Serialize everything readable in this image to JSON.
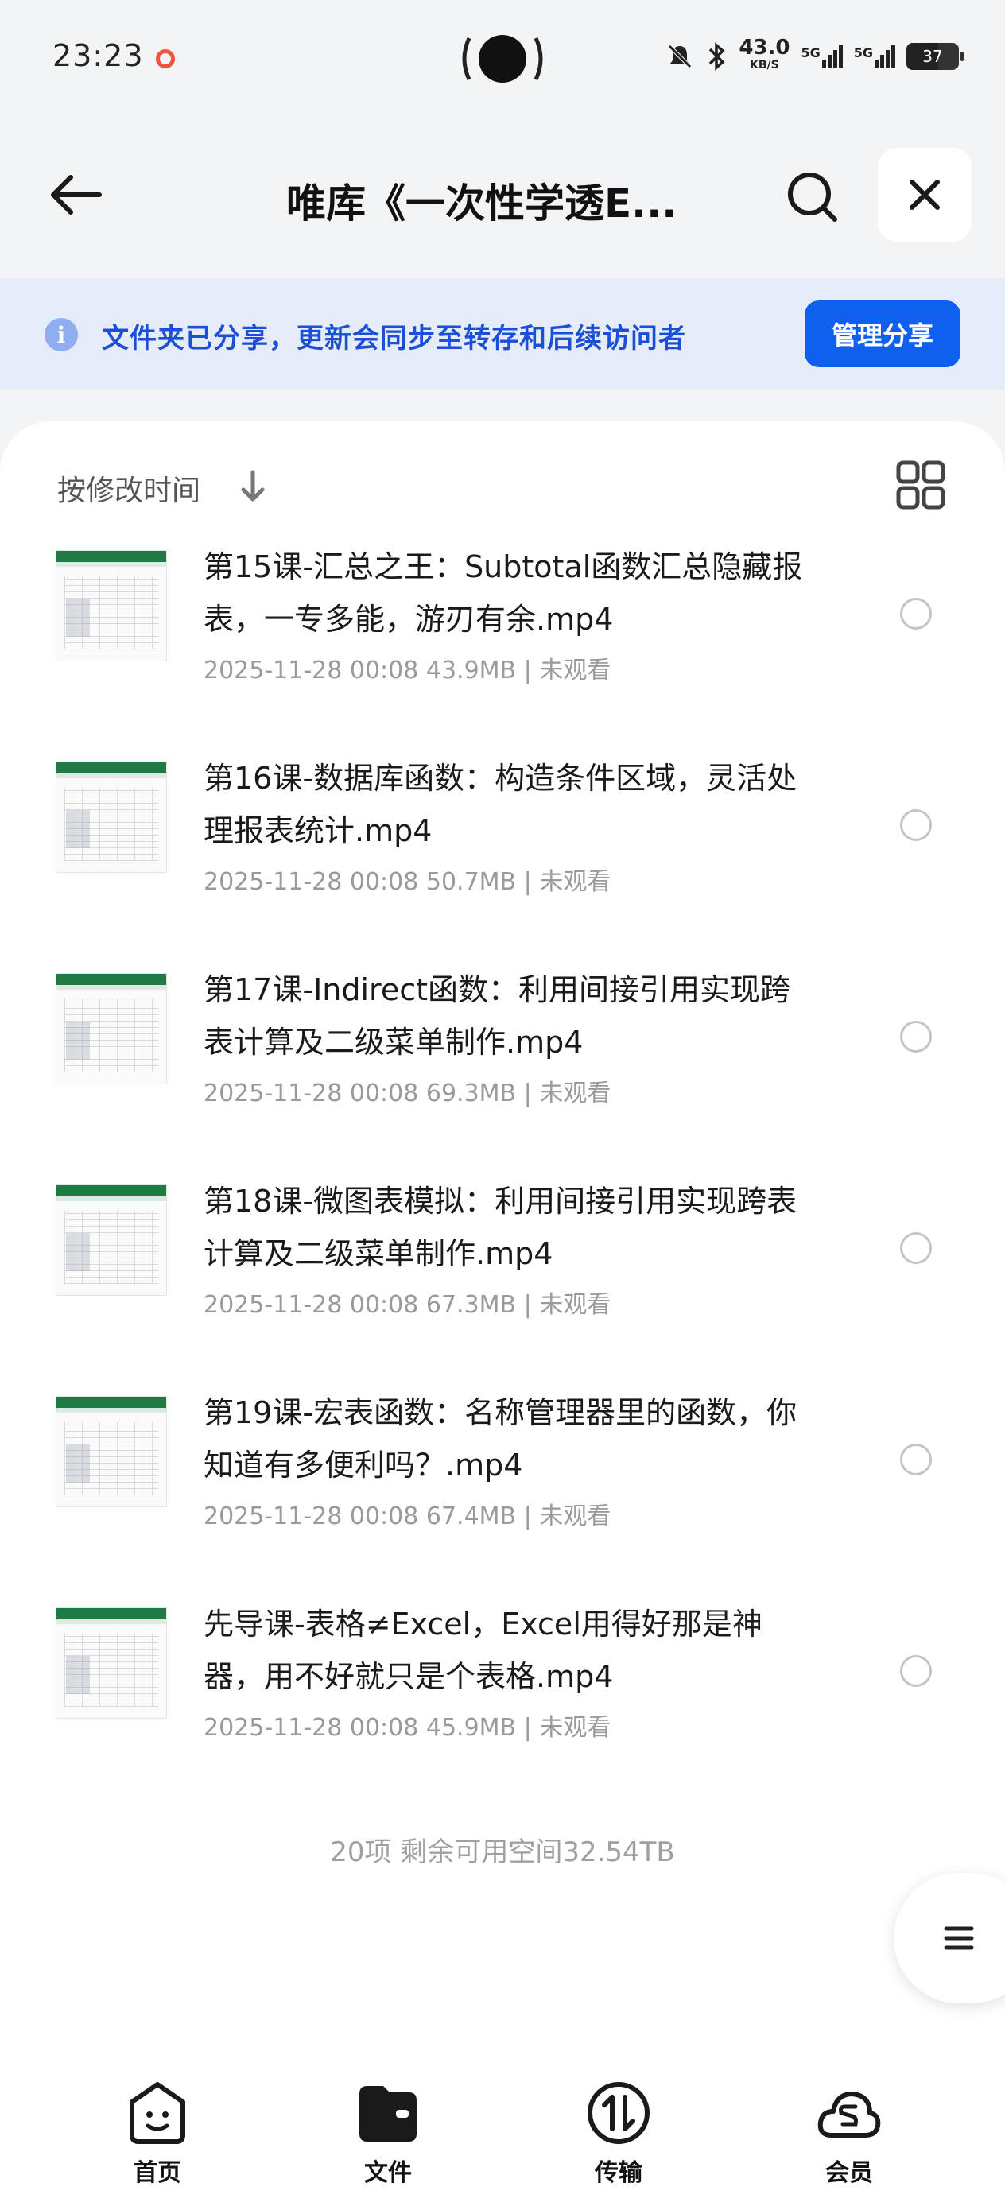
{
  "status_bar": {
    "time": "23:23",
    "speed_value": "43.0",
    "speed_unit": "KB/S",
    "signal1": "5G",
    "signal2": "5G",
    "battery": "37"
  },
  "header": {
    "title": "唯库《一次性学透E..."
  },
  "banner": {
    "info_icon_glyph": "i",
    "text": "文件夹已分享，更新会同步至转存和后续访问者",
    "manage_label": "管理分享"
  },
  "toolbar": {
    "sort_label": "按修改时间"
  },
  "files": [
    {
      "name": "第15课-汇总之王：Subtotal函数汇总隐藏报表，一专多能，游刃有余.mp4",
      "meta": "2025-11-28 00:08  43.9MB | 未观看"
    },
    {
      "name": "第16课-数据库函数：构造条件区域，灵活处理报表统计.mp4",
      "meta": "2025-11-28 00:08  50.7MB | 未观看"
    },
    {
      "name": "第17课-Indirect函数：利用间接引用实现跨表计算及二级菜单制作.mp4",
      "meta": "2025-11-28 00:08  69.3MB | 未观看"
    },
    {
      "name": "第18课-微图表模拟：利用间接引用实现跨表计算及二级菜单制作.mp4",
      "meta": "2025-11-28 00:08  67.3MB | 未观看"
    },
    {
      "name": "第19课-宏表函数：名称管理器里的函数，你知道有多便利吗？.mp4",
      "meta": "2025-11-28 00:08  67.4MB | 未观看"
    },
    {
      "name": "先导课-表格≠Excel，Excel用得好那是神器，用不好就只是个表格.mp4",
      "meta": "2025-11-28 00:08  45.9MB | 未观看"
    }
  ],
  "summary": "20项 剩余可用空间32.54TB",
  "bottom_nav": [
    {
      "label": "首页",
      "icon": "home-face-icon"
    },
    {
      "label": "文件",
      "icon": "folder-icon"
    },
    {
      "label": "传输",
      "icon": "transfer-icon"
    },
    {
      "label": "会员",
      "icon": "vip-cloud-icon"
    }
  ],
  "colors": {
    "accent": "#1060f0",
    "banner_bg": "#e6ecf7",
    "banner_text": "#1a4fd6",
    "meta_text": "#9a9a9a"
  }
}
